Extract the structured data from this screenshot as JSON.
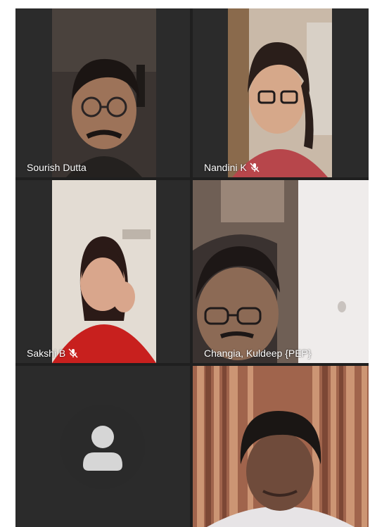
{
  "call": {
    "participants": [
      {
        "name": "Sourish Dutta",
        "muted": false
      },
      {
        "name": "Nandini K",
        "muted": true
      },
      {
        "name": "Sakshi B",
        "muted": true
      },
      {
        "name": "Changia, Kuldeep {PEP}",
        "muted": false,
        "active_speaker": true
      },
      {
        "name": "",
        "video": false
      },
      {
        "name": "",
        "muted": false
      }
    ],
    "colors": {
      "background": "#1f1f1f",
      "tile": "#2b2b2b",
      "active_border": "#7b83eb",
      "label_text": "#ffffff"
    },
    "icons": [
      "mic-off-icon",
      "person-avatar-icon"
    ]
  }
}
